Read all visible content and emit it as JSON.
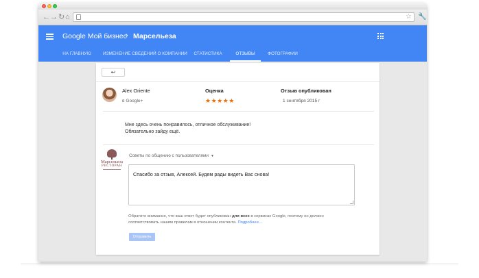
{
  "colors": {
    "accent": "#4285f4",
    "star": "#ef6c00",
    "send_disabled": "#a9c4f5"
  },
  "header": {
    "app_title": "Google Мой бизнес",
    "separator_icon": "chevron-right-icon",
    "business_name": "Марсельеза",
    "menu_icon": "menu-icon",
    "apps_icon": "apps-grid-icon"
  },
  "tabs": [
    {
      "label": "На главную",
      "active": false
    },
    {
      "label": "Изменение сведений о компании",
      "active": false
    },
    {
      "label": "Статистика",
      "active": false
    },
    {
      "label": "Отзывы",
      "active": true
    },
    {
      "label": "Фотографии",
      "active": false
    }
  ],
  "review": {
    "back_icon": "reply-arrow-icon",
    "reviewer_name": "Alex Oriente",
    "reviewer_source": "в Google+",
    "rating_label": "Оценка",
    "rating_value": 5,
    "rating_stars": "★★★★★",
    "published_label": "Отзыв опубликован",
    "published_date": "1 сентября 2015 г",
    "text_line1": "Мне здесь очень понравилось, отличное обслуживание!",
    "text_line2": "Обязательно зайду ещё."
  },
  "owner_reply": {
    "logo_name": "Марсельеза",
    "logo_subtitle": "РЕСТОРАН",
    "tips_label": "Советы по общению с пользователями",
    "reply_text": "Спасибо за отзыв, Алексей. Будем рады видеть Вас снова!",
    "notice_part1": "Обратите внимание, что ваш ответ будет опубликован ",
    "notice_bold": "для всех",
    "notice_part2": " в сервисах Google, поэтому он должен",
    "notice_line2": "соответствовать нашим правилам в отношении контента. ",
    "notice_link": "Подробнее…",
    "send_label": "Отправить"
  }
}
